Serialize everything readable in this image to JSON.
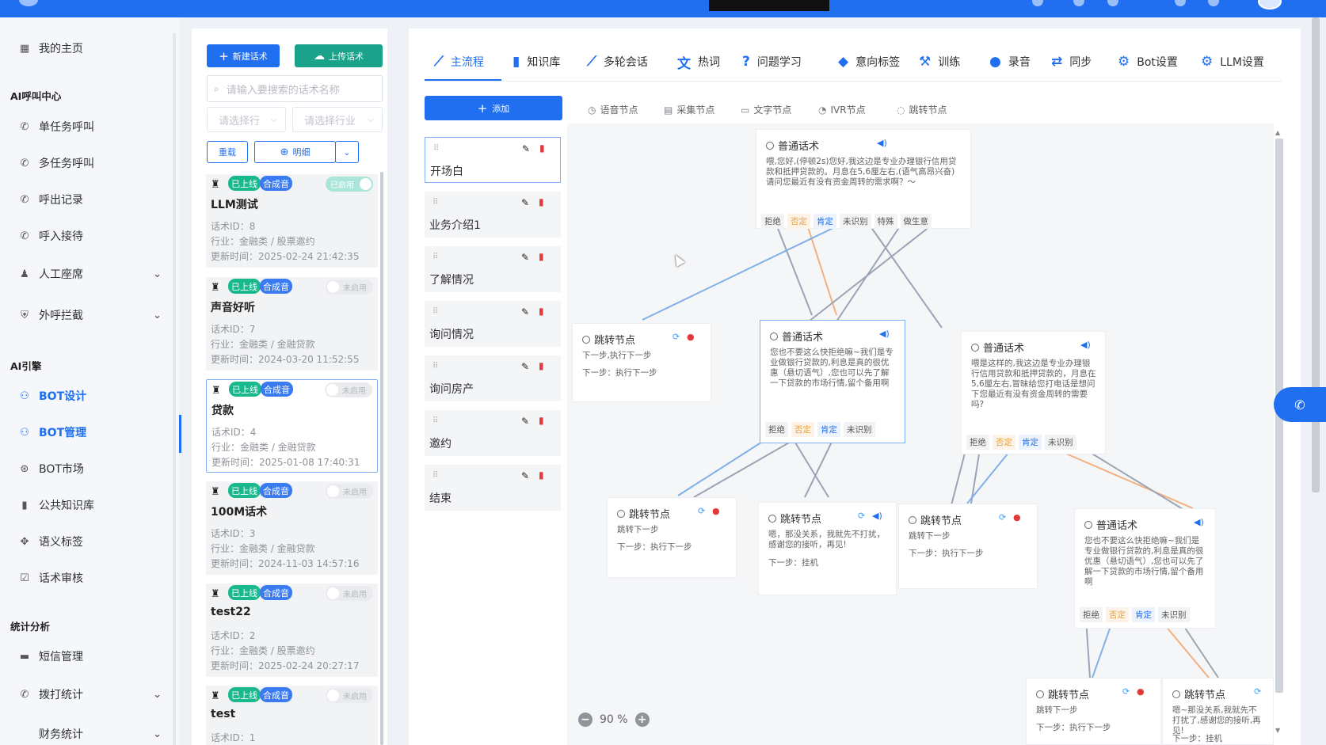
{
  "sidebar": {
    "home": "我的主页",
    "section_ai_call": "AI呼叫中心",
    "single_call": "单任务呼叫",
    "multi_call": "多任务呼叫",
    "out_records": "呼出记录",
    "inbound": "呼入接待",
    "manual_seat": "人工座席",
    "outbound_block": "外呼拦截",
    "section_ai_engine": "AI引擎",
    "bot_design": "BOT设计",
    "bot_manage": "BOT管理",
    "bot_market": "BOT市场",
    "public_kb": "公共知识库",
    "semantic_tags": "语义标签",
    "script_review": "话术审核",
    "section_stats": "统计分析",
    "sms_manage": "短信管理",
    "dial_stats": "拨打统计",
    "finance_stats": "财务统计"
  },
  "list_panel": {
    "new_button": "新建话术",
    "upload_button": "上传话术",
    "search_placeholder": "请输入要搜索的话术名称",
    "select_rank": "请选择行",
    "select_industry": "请选择行业",
    "reset_button": "重载",
    "tag_button": "明细",
    "cards": [
      {
        "status": "已上线",
        "voice": "合成音",
        "toggle": "已启用",
        "enabled": true,
        "title": "LLM测试",
        "id": "话术ID：8",
        "industry": "行业：金融类 / 股票邀约",
        "updated": "更新时间：2025-02-24 21:42:35"
      },
      {
        "status": "已上线",
        "voice": "合成音",
        "toggle": "未启用",
        "enabled": false,
        "title": "声音好听",
        "id": "话术ID：7",
        "industry": "行业：金融类 / 金融贷款",
        "updated": "更新时间：2024-03-20 11:52:55"
      },
      {
        "status": "已上线",
        "voice": "合成音",
        "toggle": "未启用",
        "enabled": false,
        "title": "贷款",
        "id": "话术ID：4",
        "industry": "行业：金融类 / 金融贷款",
        "updated": "更新时间：2025-01-08 17:40:31"
      },
      {
        "status": "已上线",
        "voice": "合成音",
        "toggle": "未启用",
        "enabled": false,
        "title": "100M话术",
        "id": "话术ID：3",
        "industry": "行业：金融类 / 金融贷款",
        "updated": "更新时间：2024-11-03 14:57:16"
      },
      {
        "status": "已上线",
        "voice": "合成音",
        "toggle": "未启用",
        "enabled": false,
        "title": "test22",
        "id": "话术ID：2",
        "industry": "行业：金融类 / 股票邀约",
        "updated": "更新时间：2025-02-24 20:27:17"
      },
      {
        "status": "已上线",
        "voice": "合成音",
        "toggle": "未启用",
        "enabled": false,
        "title": "test",
        "id": "话术ID：1",
        "industry": "",
        "updated": ""
      }
    ]
  },
  "tabs": [
    "主流程",
    "知识库",
    "多轮会话",
    "热词",
    "问题学习",
    "意向标签",
    "训练",
    "录音",
    "同步",
    "Bot设置",
    "LLM设置"
  ],
  "add_button": "添加",
  "node_types": [
    "语音节点",
    "采集节点",
    "文字节点",
    "IVR节点",
    "跳转节点"
  ],
  "steps": [
    "开场白",
    "业务介绍1",
    "了解情况",
    "询问情况",
    "询问房产",
    "邀约",
    "结束"
  ],
  "nodes": {
    "top": {
      "title": "普通话术",
      "text": "喂,您好,(停顿2s)您好,我这边是专业办理银行信用贷款和抵押贷款的。月息在5,6厘左右,(语气高昂兴奋)请问您最近有没有资金周转的需求啊？～",
      "tags": [
        "拒绝",
        "否定",
        "肯定",
        "未识别",
        "特殊",
        "做生意"
      ]
    },
    "jump1": {
      "title": "跳转节点",
      "line1": "下一步,执行下一步",
      "line2": "下一步：执行下一步"
    },
    "mid": {
      "title": "普通话术",
      "text": "您也不要这么快拒绝嘛~我们是专业做银行贷款的,利息是真的很优惠（悬切语气）,您也可以先了解一下贷款的市场行情,留个备用啊",
      "tags": [
        "拒绝",
        "否定",
        "肯定",
        "未识别"
      ]
    },
    "right": {
      "title": "普通话术",
      "text": "喂是这样的,我这边是专业办理银行信用贷款和抵押贷款的，月息在5,6厘左右,冒昧给您打电话是想问下您最近有没有资金周转的需要吗?",
      "tags": [
        "拒绝",
        "否定",
        "肯定",
        "未识别"
      ]
    },
    "jump2": {
      "title": "跳转节点",
      "line1": "跳转下一步",
      "line2": "下一步：执行下一步"
    },
    "jump3": {
      "title": "跳转节点",
      "line1": "嗯，那没关系，我就先不打扰，感谢您的接听，再见!",
      "line2": "下一步：挂机"
    },
    "jump4": {
      "title": "跳转节点",
      "line1": "跳转下一步",
      "line2": "下一步：执行下一步"
    },
    "right2": {
      "title": "普通话术",
      "text": "您也不要这么快拒绝嘛~我们是专业做银行贷款的,利息是真的很优惠（悬切语气）,您也可以先了解一下贷款的市场行情,留个备用啊",
      "tags": [
        "拒绝",
        "否定",
        "肯定",
        "未识别"
      ]
    },
    "jump5": {
      "title": "跳转节点",
      "line1": "跳转下一步",
      "line2": "下一步：执行下一步"
    },
    "jump6": {
      "title": "跳转节点",
      "line1": "嗯~那没关系,我就先不打扰了,感谢您的接听,再见!",
      "line2": "下一步：挂机"
    }
  },
  "zoom": {
    "value": "90 %"
  }
}
